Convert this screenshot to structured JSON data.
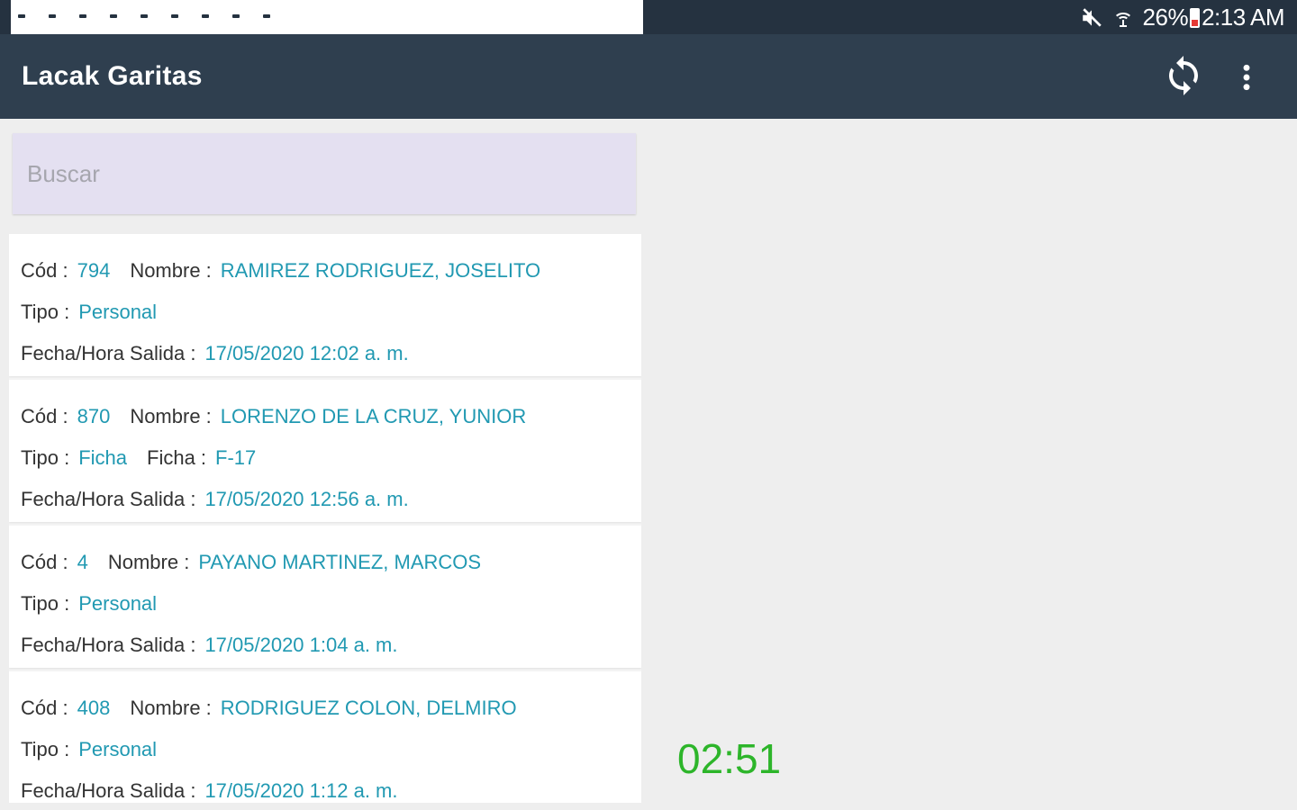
{
  "status_bar": {
    "battery": "26%",
    "time": "2:13 AM",
    "notification_icons": [
      "card-icon",
      "notification-icon",
      "notification-icon",
      "notification-icon",
      "notification-icon",
      "notification-icon",
      "notification-icon",
      "notification-icon",
      "notification-icon",
      "notification-icon",
      "book-icon"
    ]
  },
  "app_bar": {
    "title": "Lacak Garitas",
    "sync_icon": "sync-icon",
    "more_icon": "more-vert-icon"
  },
  "search": {
    "placeholder": "Buscar",
    "value": ""
  },
  "labels": {
    "cod": "Cód :",
    "nombre": "Nombre :",
    "tipo": "Tipo :",
    "ficha": "Ficha :",
    "fecha": "Fecha/Hora Salida :"
  },
  "records": [
    {
      "cod": "794",
      "nombre": "RAMIREZ RODRIGUEZ, JOSELITO",
      "tipo": "Personal",
      "ficha": "",
      "fecha": "17/05/2020 12:02 a. m."
    },
    {
      "cod": "870",
      "nombre": "LORENZO DE LA CRUZ, YUNIOR",
      "tipo": "Ficha",
      "ficha": "F-17",
      "fecha": "17/05/2020 12:56 a. m."
    },
    {
      "cod": "4",
      "nombre": "PAYANO MARTINEZ, MARCOS",
      "tipo": "Personal",
      "ficha": "",
      "fecha": "17/05/2020 1:04 a. m."
    },
    {
      "cod": "408",
      "nombre": "RODRIGUEZ COLON, DELMIRO",
      "tipo": "Personal",
      "ficha": "",
      "fecha": "17/05/2020 1:12 a. m."
    }
  ],
  "timer": "02:51",
  "colors": {
    "status_bar": "#253240",
    "app_bar": "#2f3f4f",
    "value_text": "#2199b2",
    "timer": "#2db52a",
    "search_bg": "#e4e0f1"
  }
}
